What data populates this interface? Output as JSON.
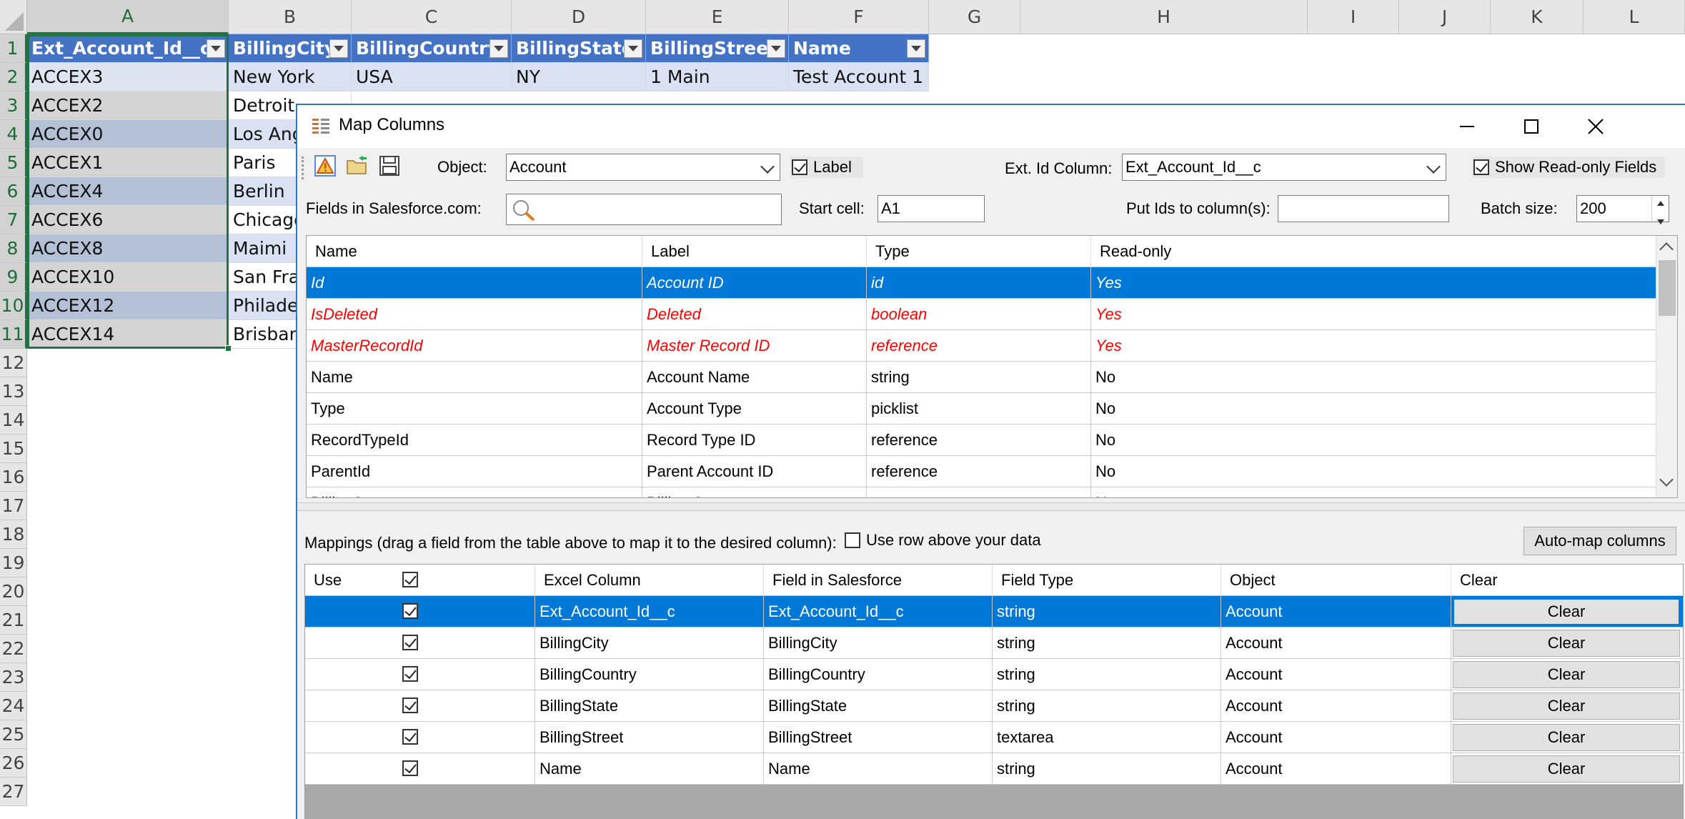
{
  "sheet": {
    "columns": [
      "A",
      "B",
      "C",
      "D",
      "E",
      "F",
      "G",
      "H",
      "I",
      "J",
      "K",
      "L"
    ],
    "rows": [
      "1",
      "2",
      "3",
      "4",
      "5",
      "6",
      "7",
      "8",
      "9",
      "10",
      "11",
      "12",
      "13",
      "14",
      "15",
      "16",
      "17",
      "18",
      "19",
      "20",
      "21",
      "22",
      "23",
      "24",
      "25",
      "26",
      "27"
    ],
    "header_cells": [
      "Ext_Account_Id__c",
      "BillingCity",
      "BillingCountry",
      "BillingState",
      "BillingStreet",
      "Name"
    ],
    "row2": [
      "ACCEX3",
      "New York",
      "USA",
      "NY",
      "1 Main",
      "Test Account 1"
    ],
    "colA": [
      "ACCEX2",
      "ACCEX0",
      "ACCEX1",
      "ACCEX4",
      "ACCEX6",
      "ACCEX8",
      "ACCEX10",
      "ACCEX12",
      "ACCEX14"
    ],
    "colB": [
      "Detroit",
      "Los Ang",
      "Paris",
      "Berlin",
      "Chicago",
      "Maimi",
      "San Fra",
      "Philade",
      "Brisban"
    ]
  },
  "dialog": {
    "title": "Map Columns",
    "object_label": "Object:",
    "object_value": "Account",
    "label_checkbox": "Label",
    "ext_id_label": "Ext. Id Column:",
    "ext_id_value": "Ext_Account_Id__c",
    "show_readonly": "Show Read-only Fields",
    "fields_label": "Fields in Salesforce.com:",
    "start_cell_label": "Start cell:",
    "start_cell_value": "A1",
    "put_ids_label": "Put Ids to column(s):",
    "put_ids_value": "",
    "batch_label": "Batch size:",
    "batch_value": "200",
    "fields_table": {
      "headers": [
        "Name",
        "Label",
        "Type",
        "Read-only"
      ],
      "rows": [
        [
          "Id",
          "Account ID",
          "id",
          "Yes"
        ],
        [
          "IsDeleted",
          "Deleted",
          "boolean",
          "Yes"
        ],
        [
          "MasterRecordId",
          "Master Record ID",
          "reference",
          "Yes"
        ],
        [
          "Name",
          "Account Name",
          "string",
          "No"
        ],
        [
          "Type",
          "Account Type",
          "picklist",
          "No"
        ],
        [
          "RecordTypeId",
          "Record Type ID",
          "reference",
          "No"
        ],
        [
          "ParentId",
          "Parent Account ID",
          "reference",
          "No"
        ],
        [
          "BillingStreet",
          "Billing Street",
          "textarea",
          "No"
        ]
      ]
    },
    "mappings_label": "Mappings (drag a field from the table above to map it to the desired column):",
    "use_row_above": "Use row above your data",
    "automap_button": "Auto-map columns",
    "mappings_table": {
      "headers": [
        "Use",
        "Excel Column",
        "Field in Salesforce",
        "Field Type",
        "Object",
        "Clear"
      ],
      "rows": [
        [
          "Ext_Account_Id__c",
          "Ext_Account_Id__c",
          "string",
          "Account",
          "Clear"
        ],
        [
          "BillingCity",
          "BillingCity",
          "string",
          "Account",
          "Clear"
        ],
        [
          "BillingCountry",
          "BillingCountry",
          "string",
          "Account",
          "Clear"
        ],
        [
          "BillingState",
          "BillingState",
          "string",
          "Account",
          "Clear"
        ],
        [
          "BillingStreet",
          "BillingStreet",
          "textarea",
          "Account",
          "Clear"
        ],
        [
          "Name",
          "Name",
          "string",
          "Account",
          "Clear"
        ]
      ]
    }
  },
  "colors": {
    "excel_header": "#4472c4",
    "excel_band": "#d9e1f2",
    "selection": "#0078d7",
    "readonly_red": "#ff0000",
    "excel_green": "#217346"
  }
}
